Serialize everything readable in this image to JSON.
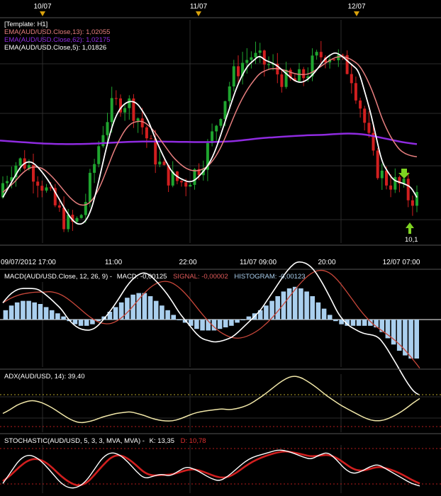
{
  "top_dates": [
    "10/07",
    "11/07",
    "12/07"
  ],
  "time_axis": [
    "09/07/2012 17:00",
    "11:00",
    "22:00",
    "11/07 09:00",
    "20:00",
    "12/07 07:00"
  ],
  "price_panel": {
    "template": "[Template: H1]",
    "legend": [
      {
        "text": "EMA(AUD/USD.Close,13): 1,02055",
        "color": "#e87f7f"
      },
      {
        "text": "EMA(AUD/USD.Close,62): 1,02175",
        "color": "#8f2be0"
      },
      {
        "text": "EMA(AUD/USD.Close,5): 1,01826",
        "color": "#ffffff"
      }
    ],
    "price_tag": "10,1"
  },
  "macd_panel": {
    "label": "MACD(AUD/USD.Close, 12, 26, 9) -",
    "macd_text": "MACD: -0,00125",
    "signal_text": "SIGNAL: -0,00002",
    "histogram_text": "HISTOGRAM: -0,00123"
  },
  "adx_panel": {
    "label": "ADX(AUD/USD, 14): 39,40"
  },
  "stoch_panel": {
    "label": "STOCHASTIC(AUD/USD, 5, 3, 3, MVA, MVA) -",
    "k_text": "K: 13,35",
    "d_text": "D: 10,78"
  },
  "colors": {
    "background": "#000000",
    "grid": "#2c2c2c",
    "bull": "#1fa52f",
    "bear": "#d11f1f",
    "ema5": "#ffffff",
    "ema13": "#e87f7f",
    "ema62": "#8f2be0",
    "histogram": "#aacfee",
    "signal": "#c8473a",
    "adx": "#f1e7a8",
    "stoch_d": "#d11f1f",
    "level_line": "#b31c1c",
    "arrow": "#7ed321"
  },
  "chart_data": [
    {
      "type": "candlestick",
      "title": "[Template: H1]",
      "candle_count": 96,
      "ema5_path": [
        1.0165,
        1.0175,
        1.0185,
        1.0195,
        1.02,
        1.02,
        1.0195,
        1.0188,
        1.018,
        1.017,
        1.016,
        1.015,
        1.0142,
        1.0138,
        1.014,
        1.015,
        1.017,
        1.0195,
        1.022,
        1.024,
        1.0252,
        1.0258,
        1.026,
        1.0258,
        1.025,
        1.024,
        1.0225,
        1.0212,
        1.02,
        1.019,
        1.0185,
        1.0182,
        1.018,
        1.0182,
        1.0188,
        1.0195,
        1.0205,
        1.022,
        1.0238,
        1.0255,
        1.0272,
        1.0285,
        1.0295,
        1.03,
        1.0305,
        1.03,
        1.0298,
        1.0295,
        1.029,
        1.0285,
        1.028,
        1.0278,
        1.028,
        1.0285,
        1.0292,
        1.03,
        1.0305,
        1.0308,
        1.0305,
        1.03,
        1.0295,
        1.029,
        1.027,
        1.025,
        1.0225,
        1.02,
        1.019,
        1.0182,
        1.018,
        1.0178,
        1.0175,
        1.0165
      ],
      "ema13_path": [
        1.017,
        1.0175,
        1.018,
        1.0187,
        1.0192,
        1.0195,
        1.0195,
        1.0193,
        1.0188,
        1.0182,
        1.0175,
        1.0168,
        1.0162,
        1.0158,
        1.0157,
        1.016,
        1.0168,
        1.018,
        1.0195,
        1.021,
        1.0222,
        1.0232,
        1.0238,
        1.024,
        1.024,
        1.0236,
        1.023,
        1.0222,
        1.0214,
        1.0206,
        1.02,
        1.0195,
        1.0192,
        1.0191,
        1.0192,
        1.0195,
        1.0201,
        1.021,
        1.0222,
        1.0236,
        1.025,
        1.0262,
        1.0272,
        1.028,
        1.0287,
        1.029,
        1.0292,
        1.0292,
        1.0291,
        1.0289,
        1.0287,
        1.0286,
        1.0286,
        1.0288,
        1.0292,
        1.0296,
        1.03,
        1.0303,
        1.0304,
        1.0303,
        1.03,
        1.0296,
        1.0287,
        1.0275,
        1.026,
        1.0243,
        1.023,
        1.022,
        1.0212,
        1.0208,
        1.0206,
        1.0205
      ],
      "ema62_path": [
        1.0221,
        1.02205,
        1.022,
        1.02195,
        1.0219,
        1.02185,
        1.0218,
        1.02178,
        1.02176,
        1.02175,
        1.02175,
        1.02176,
        1.02178,
        1.0218,
        1.02184,
        1.02188,
        1.02192,
        1.02196,
        1.02198,
        1.022,
        1.02201,
        1.02201,
        1.022,
        1.02199,
        1.02198,
        1.02197,
        1.02196,
        1.02195,
        1.02195,
        1.02196,
        1.02198,
        1.022,
        1.02205,
        1.02212,
        1.0222,
        1.02228,
        1.02235,
        1.0224,
        1.02245,
        1.0225,
        1.02254,
        1.02258,
        1.02262,
        1.02264,
        1.02266,
        1.0227,
        1.02275,
        1.02278,
        1.0228,
        1.02276,
        1.02268,
        1.02255,
        1.0224,
        1.02225,
        1.0221,
        1.02195,
        1.02185,
        1.02175
      ]
    },
    {
      "type": "bar",
      "title": "MACD(AUD/USD.Close, 12, 26, 9)",
      "histogram": [
        0.0006,
        0.0009,
        0.0011,
        0.0012,
        0.0012,
        0.0011,
        0.001,
        0.0008,
        0.0006,
        0.0004,
        0.0002,
        -0.0001,
        -0.0003,
        -0.0004,
        -0.0004,
        -0.0003,
        -0.0001,
        0.0002,
        0.0005,
        0.0008,
        0.0011,
        0.0014,
        0.0016,
        0.0017,
        0.0017,
        0.0015,
        0.0012,
        0.0009,
        0.0006,
        0.0003,
        0.0,
        -0.0002,
        -0.0004,
        -0.0006,
        -0.0007,
        -0.0007,
        -0.0007,
        -0.0006,
        -0.0005,
        -0.0004,
        -0.0002,
        0.0,
        0.0002,
        0.0004,
        0.0006,
        0.0009,
        0.0012,
        0.0015,
        0.0018,
        0.002,
        0.0021,
        0.002,
        0.0018,
        0.0015,
        0.0011,
        0.0007,
        0.0003,
        -0.0001,
        -0.0003,
        -0.0004,
        -0.0004,
        -0.0004,
        -0.0004,
        -0.0004,
        -0.0005,
        -0.0008,
        -0.0012,
        -0.0016,
        -0.002,
        -0.0023,
        -0.0025,
        -0.0025
      ]
    },
    {
      "type": "line",
      "title": "ADX(AUD/USD, 14)",
      "values": [
        20,
        24,
        29,
        32,
        34,
        33,
        30,
        26,
        21,
        16,
        12,
        10,
        11,
        13,
        16,
        18,
        20,
        21,
        22,
        20,
        18,
        15,
        13,
        12,
        12,
        14,
        17,
        20,
        22,
        23,
        24,
        25,
        24,
        25,
        27,
        30,
        35,
        40,
        46,
        52,
        57,
        60,
        59,
        55,
        50,
        44,
        38,
        33,
        28,
        24,
        20,
        16,
        13,
        12,
        13,
        16,
        20,
        25,
        31,
        36
      ]
    },
    {
      "type": "line",
      "title": "STOCHASTIC(AUD/USD, 5, 3, 3, MVA, MVA)",
      "k": [
        20,
        45,
        70,
        80,
        75,
        60,
        40,
        20,
        10,
        12,
        25,
        50,
        75,
        85,
        80,
        65,
        45,
        30,
        35,
        40,
        35,
        45,
        55,
        50,
        40,
        30,
        25,
        35,
        50,
        65,
        75,
        80,
        85,
        90,
        88,
        82,
        75,
        70,
        80,
        85,
        70,
        50,
        40,
        45,
        55,
        60,
        50,
        40,
        30,
        20,
        15
      ],
      "d": [
        25,
        38,
        55,
        68,
        72,
        66,
        52,
        35,
        22,
        15,
        20,
        38,
        58,
        75,
        80,
        72,
        58,
        42,
        36,
        38,
        38,
        42,
        48,
        50,
        45,
        38,
        32,
        33,
        42,
        55,
        66,
        74,
        80,
        85,
        87,
        84,
        80,
        76,
        78,
        80,
        74,
        62,
        50,
        46,
        50,
        55,
        52,
        46,
        38,
        28,
        20
      ]
    }
  ]
}
